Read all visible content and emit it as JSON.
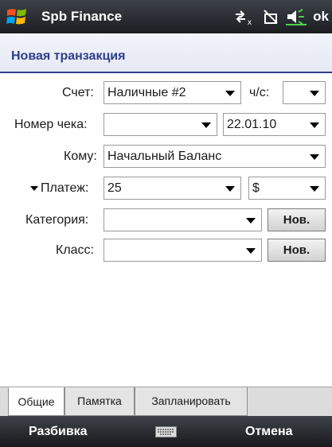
{
  "titlebar": {
    "app_title": "Spb Finance",
    "ok_label": "ok"
  },
  "header": {
    "title": "Новая транзакция"
  },
  "form": {
    "account": {
      "label": "Счет:",
      "value": "Наличные #2"
    },
    "cleared": {
      "label": "ч/с:",
      "value": ""
    },
    "check_number": {
      "label": "Номер чека:",
      "value": ""
    },
    "date": {
      "value": "22.01.10"
    },
    "payee": {
      "label": "Кому:",
      "value": "Начальный Баланс"
    },
    "payment": {
      "label": "Платеж:",
      "amount": "25",
      "currency": "$"
    },
    "category": {
      "label": "Категория:",
      "value": "",
      "new_label": "Нов."
    },
    "class": {
      "label": "Класс:",
      "value": "",
      "new_label": "Нов."
    }
  },
  "tabs": [
    {
      "label": "Общие",
      "active": true
    },
    {
      "label": "Памятка",
      "active": false
    },
    {
      "label": "Запланировать",
      "active": false
    }
  ],
  "softkeys": {
    "left": "Разбивка",
    "right": "Отмена"
  }
}
